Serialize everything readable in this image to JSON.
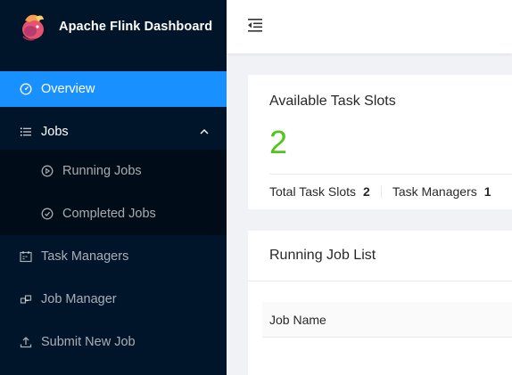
{
  "app": {
    "title": "Apache Flink Dashboard"
  },
  "sidebar": {
    "items": [
      {
        "label": "Overview",
        "icon": "dashboard-icon"
      },
      {
        "label": "Jobs",
        "icon": "list-icon",
        "expanded": true,
        "children": [
          {
            "label": "Running Jobs",
            "icon": "play-circle-icon"
          },
          {
            "label": "Completed Jobs",
            "icon": "check-circle-icon"
          }
        ]
      },
      {
        "label": "Task Managers",
        "icon": "schedule-icon"
      },
      {
        "label": "Job Manager",
        "icon": "build-icon"
      },
      {
        "label": "Submit New Job",
        "icon": "upload-icon"
      }
    ],
    "selected": "Overview"
  },
  "header": {
    "menu_toggle_icon": "menu-fold-icon"
  },
  "task_slots": {
    "title": "Available Task Slots",
    "value": "2",
    "total_label": "Total Task Slots",
    "total_value": "2",
    "managers_label": "Task Managers",
    "managers_value": "1"
  },
  "running_jobs": {
    "title": "Running Job List",
    "columns": [
      "Job Name"
    ]
  },
  "colors": {
    "sidebar": "#001529",
    "accent": "#1890ff",
    "value": "#52c41a"
  }
}
